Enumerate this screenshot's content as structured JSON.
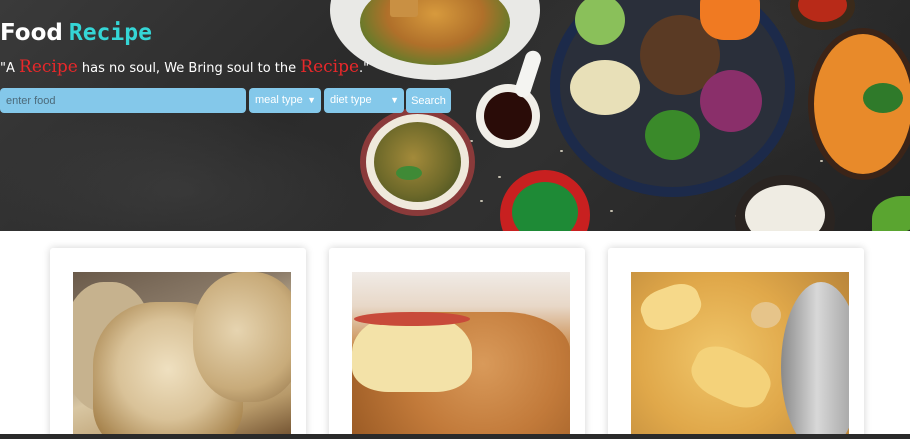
{
  "hero": {
    "title_word1": "Food",
    "title_word2": "Recipe",
    "tagline": {
      "part1": "\"A ",
      "highlight1": "Recipe",
      "part2": " has no soul, We Bring soul to the ",
      "highlight2": "Recipe",
      "part3": ".\""
    }
  },
  "search": {
    "placeholder": "enter food",
    "meal_type_label": "meal type",
    "diet_type_label": "diet type",
    "button_label": "Search"
  },
  "icons": {
    "dropdown": "chevron-down-icon"
  },
  "colors": {
    "accent_title": "#35d6d6",
    "highlight_red": "#e8282a",
    "control_blue": "#84c8ea"
  },
  "cards": [
    {
      "image": "rice-ball-photo"
    },
    {
      "image": "apple-fritter-photo"
    },
    {
      "image": "pasta-chickpea-photo"
    }
  ]
}
